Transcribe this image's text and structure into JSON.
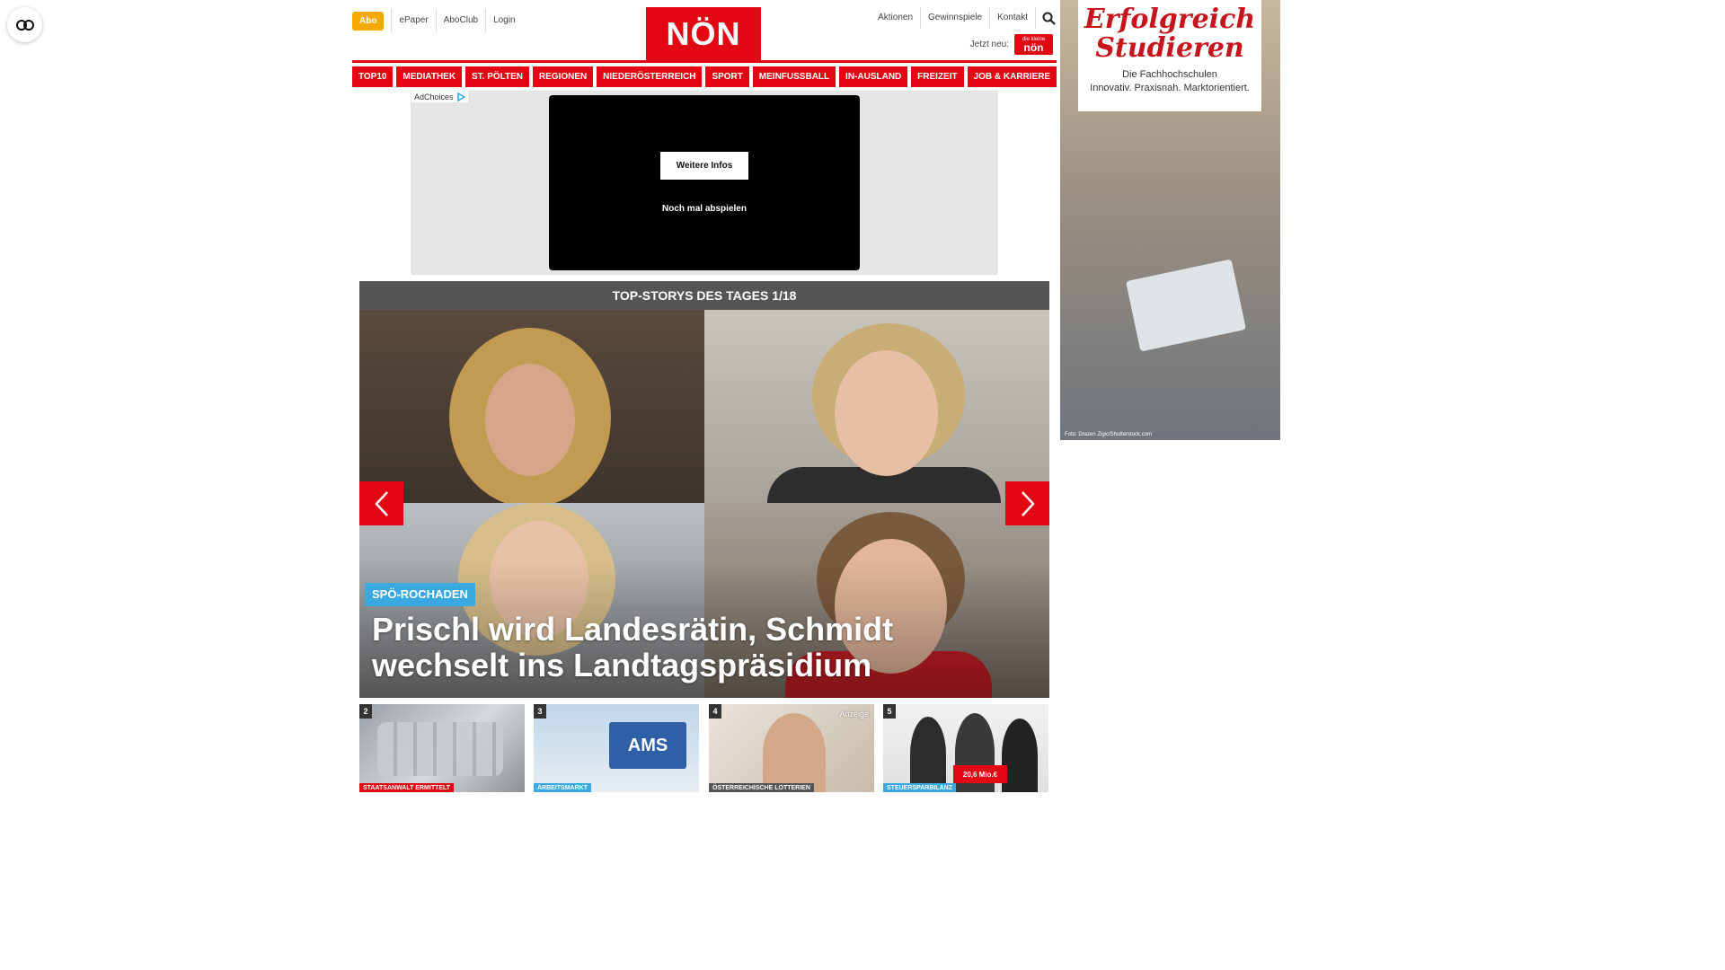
{
  "header": {
    "abo": "Abo",
    "left_links": [
      "ePaper",
      "AboClub",
      "Login"
    ],
    "logo": "NÖN",
    "right_links": [
      "Aktionen",
      "Gewinnspiele",
      "Kontakt"
    ],
    "jetzt_neu": "Jetzt neu:",
    "mini_logo_top": "die kleine",
    "mini_logo": "nön"
  },
  "nav": [
    "TOP10",
    "MEDIATHEK",
    "ST. PÖLTEN",
    "REGIONEN",
    "NIEDERÖSTERREICH",
    "SPORT",
    "MEINFUSSBALL",
    "IN-AUSLAND",
    "FREIZEIT",
    "JOB & KARRIERE"
  ],
  "ad": {
    "adchoices": "AdChoices",
    "more_info": "Weitere Infos",
    "replay": "Noch mal abspielen"
  },
  "top_stories": {
    "header": "TOP-STORYS DES TAGES 1/18",
    "hero_tag": "SPÖ-ROCHADEN",
    "hero_title": "Prischl wird Landesrätin, Schmidt wechselt ins Landtagspräsidium"
  },
  "thumbs": [
    {
      "num": "2",
      "tag": "STAATSANWALT ERMITTELT"
    },
    {
      "num": "3",
      "tag": "ARBEITSMARKT",
      "sign": "AMS"
    },
    {
      "num": "4",
      "tag": "ÖSTERREICHISCHE LOTTERIEN",
      "anzeige": "Anzeige"
    },
    {
      "num": "5",
      "tag": "STEUERSPARBILANZ",
      "cheque": "20,6 Mio.€"
    }
  ],
  "side_ad": {
    "title_line1": "Erfolgreich",
    "title_line2": "Studieren",
    "sub_line1": "Die Fachhochschulen",
    "sub_line2": "Innovativ. Praxisnah. Marktorientiert.",
    "credit": "Foto: Drazen Zigic/Shutterstock.com"
  },
  "colors": {
    "brand_red": "#e30613",
    "abo_orange": "#f5a800",
    "tag_blue": "#3aa9e0",
    "header_gray": "#555555"
  },
  "icons": [
    "accessibility-icon",
    "search-icon",
    "adchoices-icon",
    "chevron-left-icon",
    "chevron-right-icon"
  ]
}
